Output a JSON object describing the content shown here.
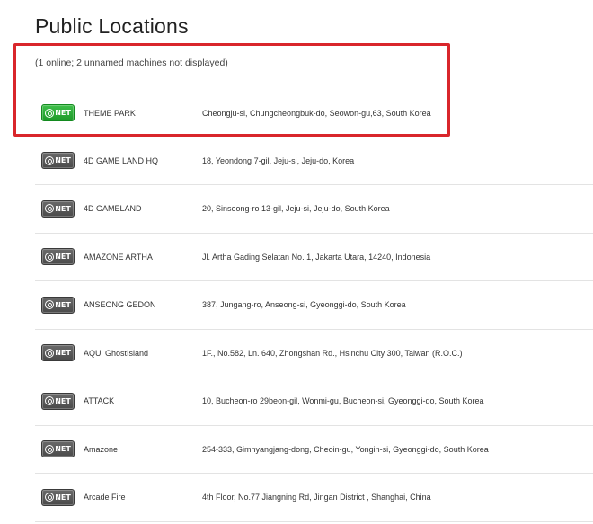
{
  "page": {
    "title": "Public Locations",
    "summary": "(1 online; 2 unnamed machines not displayed)",
    "highlight_color": "#d9262b"
  },
  "badge": {
    "label": "NET",
    "online_color": "#2db23a",
    "offline_color": "#555555"
  },
  "locations": [
    {
      "name": "THEME PARK",
      "address": "Cheongju-si, Chungcheongbuk-do, Seowon-gu,63, South Korea",
      "online": true
    },
    {
      "name": "4D GAME LAND HQ",
      "address": "18, Yeondong 7-gil, Jeju-si, Jeju-do, Korea",
      "online": false
    },
    {
      "name": "4D GAMELAND",
      "address": "20, Sinseong-ro 13-gil, Jeju-si, Jeju-do, South Korea",
      "online": false
    },
    {
      "name": "AMAZONE ARTHA",
      "address": "Jl. Artha Gading Selatan No. 1, Jakarta Utara, 14240, Indonesia",
      "online": false
    },
    {
      "name": "ANSEONG GEDON",
      "address": "387, Jungang-ro, Anseong-si, Gyeonggi-do, South Korea",
      "online": false
    },
    {
      "name": "AQUi GhostIsland",
      "address": "1F., No.582, Ln. 640, Zhongshan Rd., Hsinchu City 300, Taiwan (R.O.C.)",
      "online": false
    },
    {
      "name": "ATTACK",
      "address": "10, Bucheon-ro 29beon-gil, Wonmi-gu, Bucheon-si, Gyeonggi-do, South Korea",
      "online": false
    },
    {
      "name": "Amazone",
      "address": "254-333, Gimnyangjang-dong, Cheoin-gu, Yongin-si, Gyeonggi-do, South Korea",
      "online": false
    },
    {
      "name": "Arcade Fire",
      "address": "4th Floor, No.77 Jiangning Rd, Jingan District , Shanghai, China",
      "online": false
    }
  ]
}
